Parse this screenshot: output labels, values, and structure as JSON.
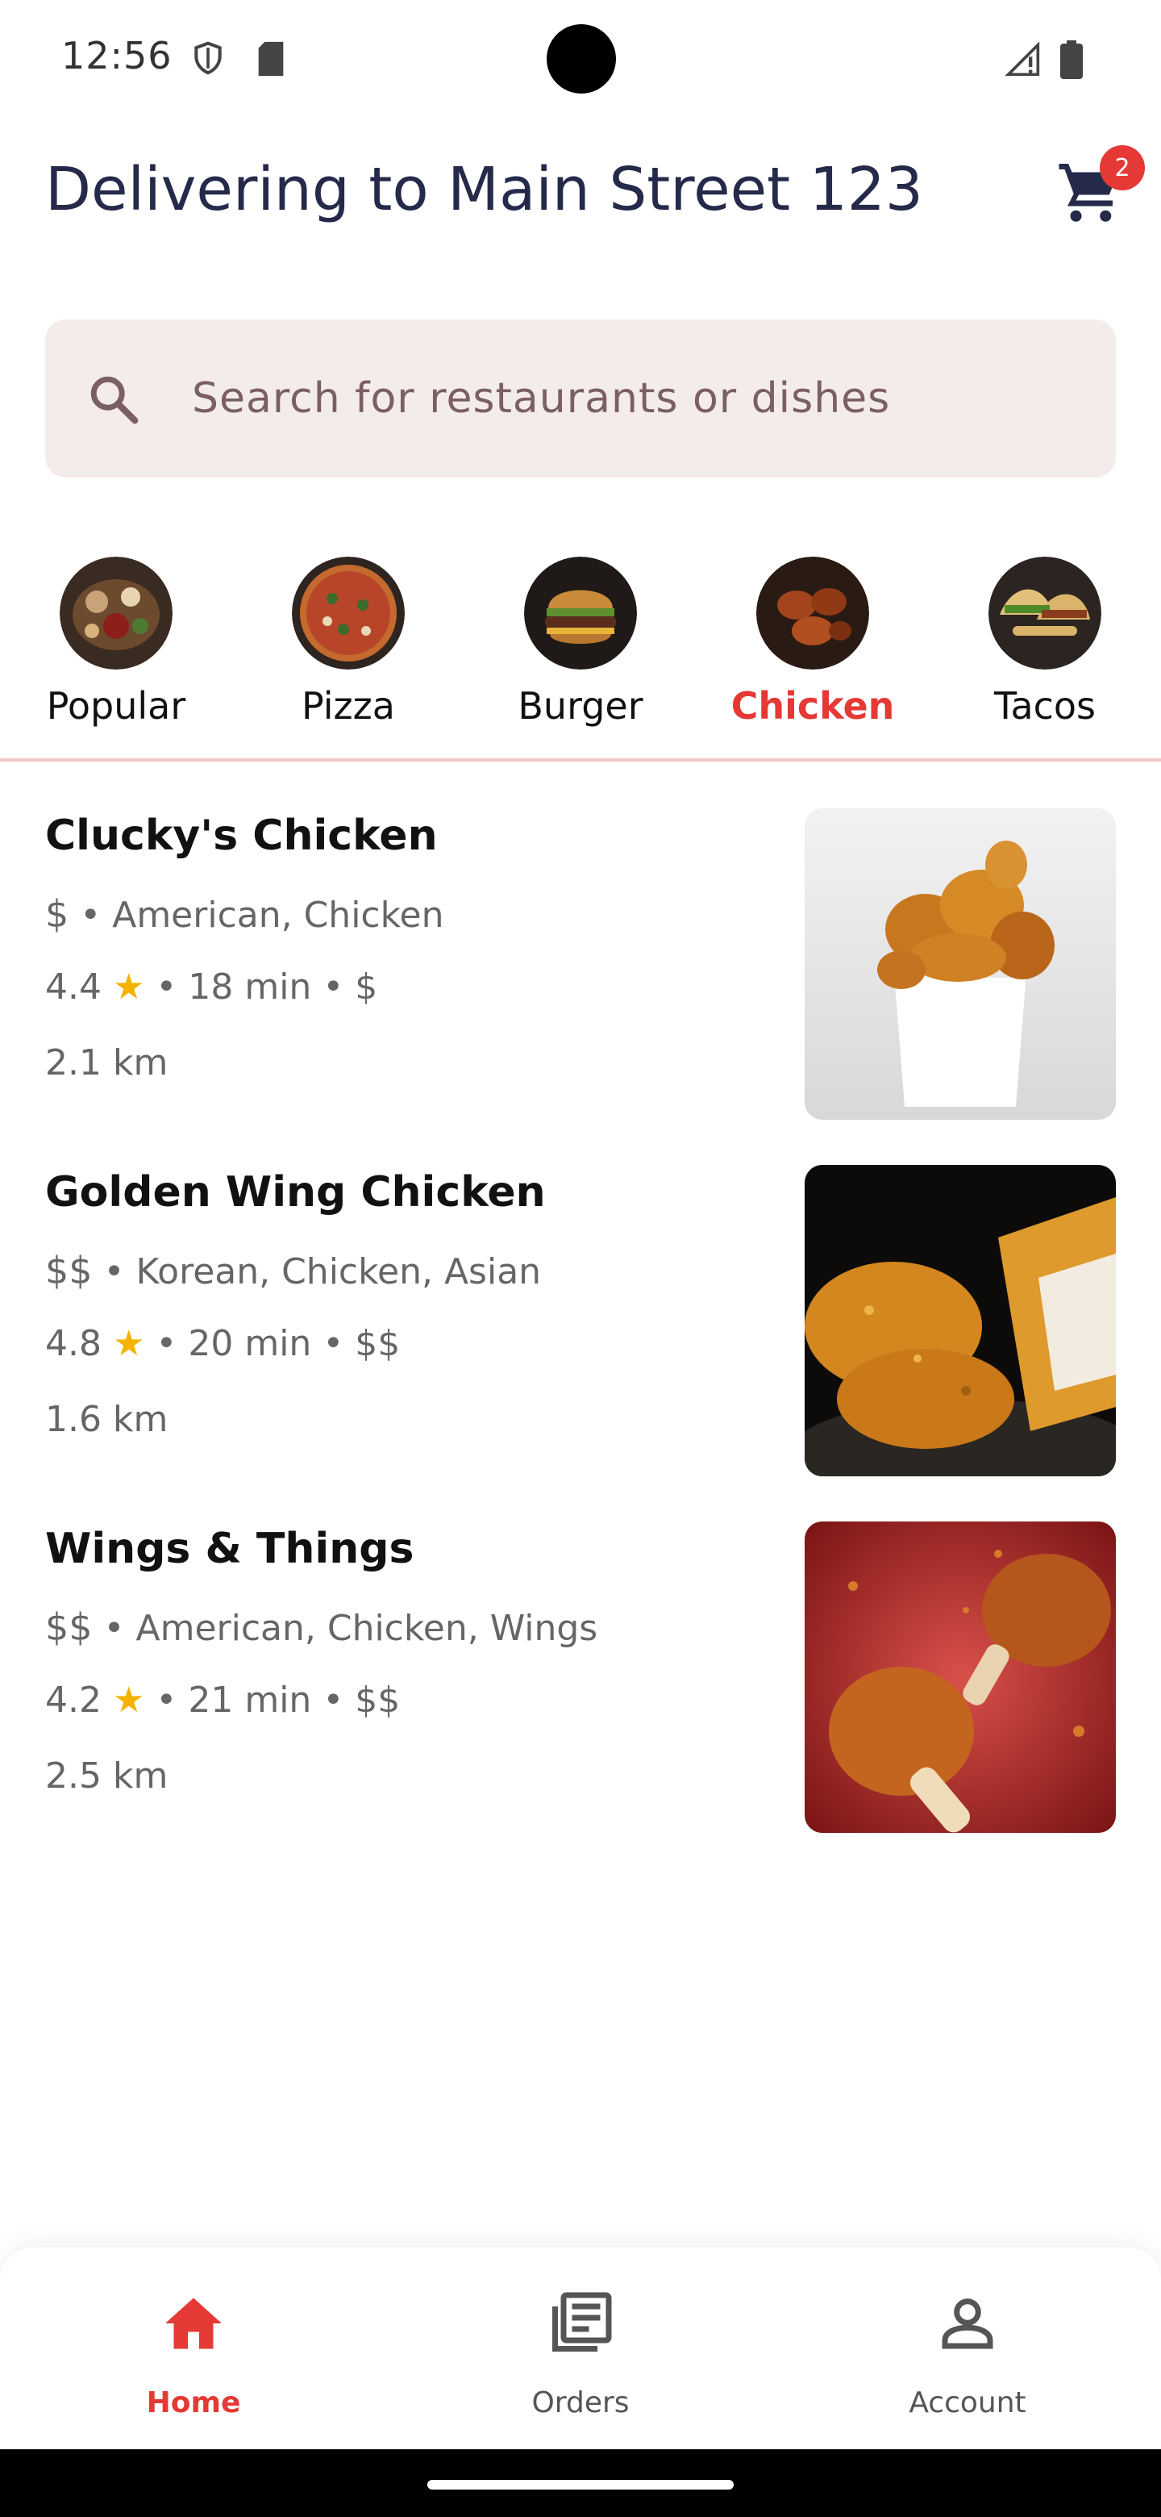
{
  "status_bar": {
    "time": "12:56"
  },
  "header": {
    "title": "Delivering to Main Street 123",
    "cart_count": "2"
  },
  "search": {
    "placeholder": "Search for restaurants or dishes"
  },
  "categories": [
    {
      "label": "Popular",
      "active": false
    },
    {
      "label": "Pizza",
      "active": false
    },
    {
      "label": "Burger",
      "active": false
    },
    {
      "label": "Chicken",
      "active": true
    },
    {
      "label": "Tacos",
      "active": false
    }
  ],
  "restaurants": [
    {
      "name": "Clucky's Chicken",
      "price_symbol": "$",
      "cuisines": "American, Chicken",
      "rating": "4.4",
      "time": "18 min",
      "price_level": "$",
      "distance": "2.1 km"
    },
    {
      "name": "Golden Wing Chicken",
      "price_symbol": "$$",
      "cuisines": "Korean, Chicken, Asian",
      "rating": "4.8",
      "time": "20 min",
      "price_level": "$$",
      "distance": "1.6 km"
    },
    {
      "name": "Wings & Things",
      "price_symbol": "$$",
      "cuisines": "American, Chicken, Wings",
      "rating": "4.2",
      "time": "21 min",
      "price_level": "$$",
      "distance": "2.5 km"
    }
  ],
  "bottom_nav": [
    {
      "label": "Home",
      "icon": "home-icon",
      "active": true
    },
    {
      "label": "Orders",
      "icon": "orders-icon",
      "active": false
    },
    {
      "label": "Account",
      "icon": "account-icon",
      "active": false
    }
  ],
  "colors": {
    "accent": "#e53935",
    "title": "#252a4a",
    "search_bg": "#f4eceb",
    "star": "#f5b301"
  }
}
